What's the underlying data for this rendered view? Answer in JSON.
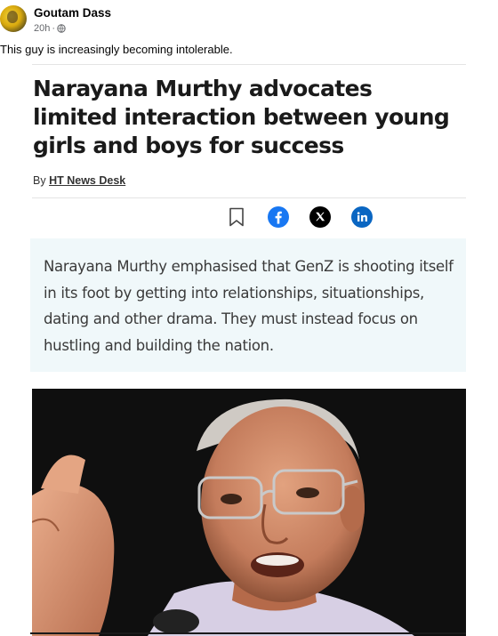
{
  "post": {
    "author": "Goutam Dass",
    "time": "20h",
    "privacy_icon": "globe-icon",
    "caption": "This guy is increasingly becoming intolerable."
  },
  "article": {
    "headline": "Narayana Murthy advocates limited interaction between young girls and boys for success",
    "byline_prefix": "By",
    "byline_author": "HT News Desk",
    "share_icons": [
      "bookmark-icon",
      "facebook-icon",
      "x-icon",
      "linkedin-icon"
    ],
    "summary": "Narayana Murthy emphasised that GenZ is shooting itself in its foot by getting into relationships, situationships, dating and other drama. They must instead focus on hustling and building the nation.",
    "colors": {
      "facebook": "#1877f2",
      "linkedin": "#0a66c2",
      "x": "#000000",
      "summary_bg": "#f0f8fa"
    }
  }
}
